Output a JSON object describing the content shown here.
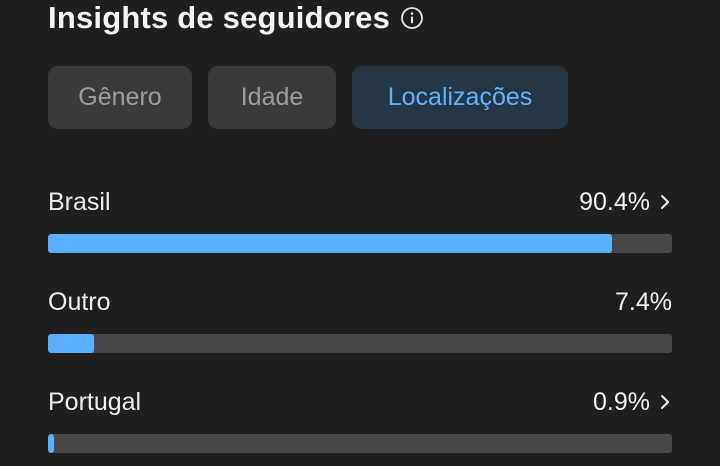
{
  "header": {
    "title": "Insights de seguidores",
    "info_icon": "info-circle-icon"
  },
  "tabs": [
    {
      "label": "Gênero",
      "selected": false
    },
    {
      "label": "Idade",
      "selected": false
    },
    {
      "label": "Localizações",
      "selected": true
    }
  ],
  "locations": [
    {
      "name": "Brasil",
      "percent_label": "90.4%",
      "value": 90.4,
      "has_chevron": true
    },
    {
      "name": "Outro",
      "percent_label": "7.4%",
      "value": 7.4,
      "has_chevron": false
    },
    {
      "name": "Portugal",
      "percent_label": "0.9%",
      "value": 0.9,
      "has_chevron": true
    }
  ],
  "colors": {
    "background": "#1f1f1f",
    "accent": "#5aafff",
    "track": "#474747",
    "tab_selected_bg": "#253645",
    "tab_bg": "#3a3a3a"
  }
}
